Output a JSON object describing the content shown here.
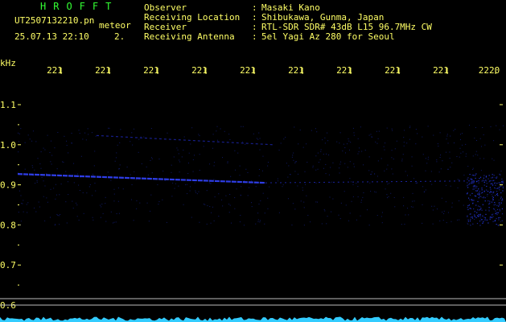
{
  "header": {
    "app_title": "HROFFT",
    "file_name": "UT2507132210.pn",
    "meteor_label": "meteor",
    "datetime": "25.07.13 22:10",
    "count": "2.",
    "info": [
      {
        "label": "Observer",
        "sep": ":",
        "value": "Masaki Kano"
      },
      {
        "label": "Receiving Location",
        "sep": ":",
        "value": "Shibukawa, Gunma, Japan"
      },
      {
        "label": "Receiver",
        "sep": ":",
        "value": "RTL-SDR SDR# 43dB L15 96.7MHz CW"
      },
      {
        "label": "Receiving Antenna",
        "sep": ":",
        "value": "5el Yagi Az 280 for Seoul"
      }
    ]
  },
  "chart_data": {
    "type": "heatmap",
    "title": "",
    "xlabel": "",
    "ylabel": "kHz",
    "x_tick_labels": [
      "221",
      "221",
      "221",
      "221",
      "221",
      "221",
      "221",
      "221",
      "221",
      "2220"
    ],
    "y_tick_labels": [
      "1.1",
      "1.0",
      "0.9",
      "0.8",
      "0.7",
      "0.6"
    ],
    "ylim": [
      0.6,
      1.1
    ],
    "echo_traces": [
      {
        "name": "main trace",
        "start_khz": 0.927,
        "end_khz": 0.905,
        "color": "#3344ff"
      },
      {
        "name": "faint upper trace",
        "start_khz": 1.023,
        "end_khz": 1.0,
        "color": "#1a2299"
      }
    ],
    "colors": {
      "background": "#000000",
      "text": "#ffff66",
      "grid": "#bbbbbb",
      "signal": "#3344ff",
      "meter": "#33ccff",
      "title": "#33ff33"
    }
  }
}
